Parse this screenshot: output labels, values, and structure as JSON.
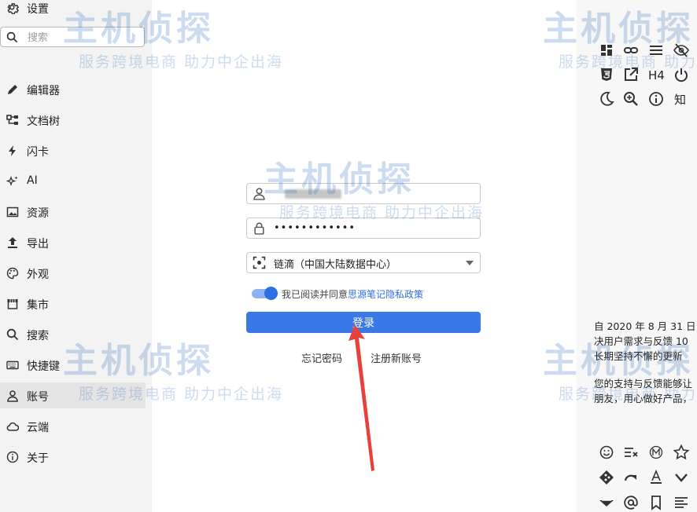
{
  "sidebar": {
    "header_label": "设置",
    "search_placeholder": "搜索",
    "items": [
      {
        "label": "编辑器",
        "icon": "pencil-icon"
      },
      {
        "label": "文档树",
        "icon": "tree-icon"
      },
      {
        "label": "闪卡",
        "icon": "flash-icon"
      },
      {
        "label": "AI",
        "icon": "sparkle-icon"
      },
      {
        "label": "资源",
        "icon": "image-icon"
      },
      {
        "label": "导出",
        "icon": "upload-icon"
      },
      {
        "label": "外观",
        "icon": "palette-icon"
      },
      {
        "label": "集市",
        "icon": "store-icon"
      },
      {
        "label": "搜索",
        "icon": "search-icon"
      },
      {
        "label": "快捷键",
        "icon": "keyboard-icon"
      },
      {
        "label": "账号",
        "icon": "user-icon",
        "active": true
      },
      {
        "label": "云端",
        "icon": "cloud-icon"
      },
      {
        "label": "关于",
        "icon": "info-icon"
      }
    ]
  },
  "login": {
    "password_mask": "••••••••••••",
    "server_selected": "链滴（中国大陆数据中心）",
    "agree_text": "我已阅读并同意",
    "agree_link": "思源笔记隐私政策",
    "agree_checked": true,
    "login_button": "登录",
    "forgot_password": "忘记密码",
    "register": "注册新账号"
  },
  "right_panel": {
    "tools": [
      "dashboard-icon",
      "link-icon",
      "menu-icon",
      "eye-off-icon",
      "html5-icon",
      "open-external-icon",
      "heading4-icon",
      "power-icon",
      "moon-icon",
      "zoom-in-icon",
      "info-icon",
      "zhi-icon"
    ],
    "h4_label": "H4",
    "zhi_label": "知",
    "description_lines": [
      "自 2020 年 8 月 31 日",
      "决用户需求与反馈 10",
      "长期坚持不懈的更新",
      "",
      "您的支持与反馈能够让",
      "朋友，用心做好产品，"
    ],
    "bottom_tools": [
      "emoji-icon",
      "clear-format-icon",
      "m-circle-icon",
      "star-icon",
      "git-icon",
      "redo-icon",
      "font-color-icon",
      "chevron-down-icon",
      "layers-icon",
      "at-icon",
      "bookmark-icon",
      "align-left-icon"
    ]
  },
  "watermark": {
    "brand": "主机侦探",
    "tagline": "服务跨境电商 助力中企出海"
  },
  "colors": {
    "accent": "#3b78e7",
    "sidebar_bg": "#f3f3f3",
    "arrow": "#e8413c"
  }
}
